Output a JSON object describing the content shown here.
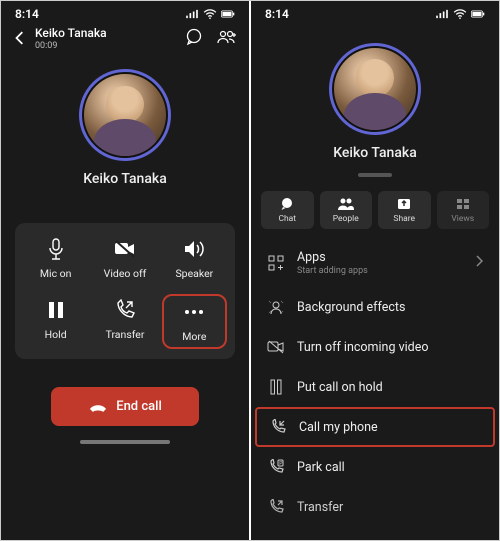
{
  "left": {
    "status_time": "8:14",
    "top": {
      "name": "Keiko Tanaka",
      "sub": "00:09"
    },
    "avatar_name": "Keiko Tanaka",
    "actions": {
      "mic": "Mic on",
      "video": "Video off",
      "speaker": "Speaker",
      "hold": "Hold",
      "transfer": "Transfer",
      "more": "More"
    },
    "end_call": "End call"
  },
  "right": {
    "status_time": "8:14",
    "avatar_name": "Keiko Tanaka",
    "quick": {
      "chat": "Chat",
      "people": "People",
      "share": "Share",
      "views": "Views"
    },
    "menu": {
      "apps": "Apps",
      "apps_sub": "Start adding apps",
      "bg": "Background effects",
      "turnoff": "Turn off incoming video",
      "hold": "Put call on hold",
      "callphone": "Call my phone",
      "park": "Park call",
      "transfer": "Transfer"
    }
  }
}
